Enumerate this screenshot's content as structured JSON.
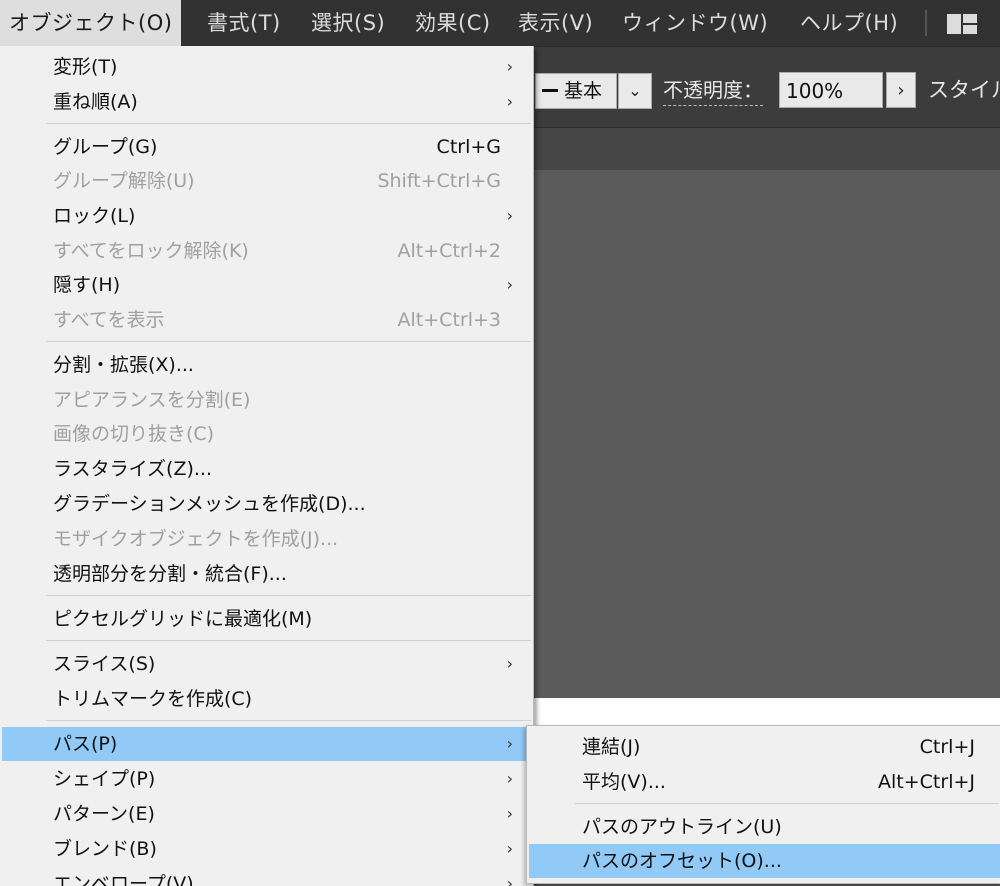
{
  "menubar": {
    "items": [
      "オブジェクト(O)",
      "書式(T)",
      "選択(S)",
      "効果(C)",
      "表示(V)",
      "ウィンドウ(W)",
      "ヘルプ(H)"
    ],
    "workspace_icon": "workspace-layout-icon"
  },
  "controlbar": {
    "stroke_style": "基本",
    "opacity_label": "不透明度：",
    "opacity_value": "100%",
    "style_label": "スタイル"
  },
  "object_menu": {
    "items": [
      {
        "label": "変形(T)",
        "shortcut": "",
        "submenu": true,
        "disabled": false
      },
      {
        "label": "重ね順(A)",
        "shortcut": "",
        "submenu": true,
        "disabled": false
      },
      {
        "label": "グループ(G)",
        "shortcut": "Ctrl+G",
        "submenu": false,
        "disabled": false
      },
      {
        "label": "グループ解除(U)",
        "shortcut": "Shift+Ctrl+G",
        "submenu": false,
        "disabled": true
      },
      {
        "label": "ロック(L)",
        "shortcut": "",
        "submenu": true,
        "disabled": false
      },
      {
        "label": "すべてをロック解除(K)",
        "shortcut": "Alt+Ctrl+2",
        "submenu": false,
        "disabled": true
      },
      {
        "label": "隠す(H)",
        "shortcut": "",
        "submenu": true,
        "disabled": false
      },
      {
        "label": "すべてを表示",
        "shortcut": "Alt+Ctrl+3",
        "submenu": false,
        "disabled": true
      },
      {
        "label": "分割・拡張(X)...",
        "shortcut": "",
        "submenu": false,
        "disabled": false
      },
      {
        "label": "アピアランスを分割(E)",
        "shortcut": "",
        "submenu": false,
        "disabled": true
      },
      {
        "label": "画像の切り抜き(C)",
        "shortcut": "",
        "submenu": false,
        "disabled": true
      },
      {
        "label": "ラスタライズ(Z)...",
        "shortcut": "",
        "submenu": false,
        "disabled": false
      },
      {
        "label": "グラデーションメッシュを作成(D)...",
        "shortcut": "",
        "submenu": false,
        "disabled": false
      },
      {
        "label": "モザイクオブジェクトを作成(J)...",
        "shortcut": "",
        "submenu": false,
        "disabled": true
      },
      {
        "label": "透明部分を分割・統合(F)...",
        "shortcut": "",
        "submenu": false,
        "disabled": false
      },
      {
        "label": "ピクセルグリッドに最適化(M)",
        "shortcut": "",
        "submenu": false,
        "disabled": false
      },
      {
        "label": "スライス(S)",
        "shortcut": "",
        "submenu": true,
        "disabled": false
      },
      {
        "label": "トリムマークを作成(C)",
        "shortcut": "",
        "submenu": false,
        "disabled": false
      },
      {
        "label": "パス(P)",
        "shortcut": "",
        "submenu": true,
        "disabled": false,
        "highlighted": true
      },
      {
        "label": "シェイプ(P)",
        "shortcut": "",
        "submenu": true,
        "disabled": false
      },
      {
        "label": "パターン(E)",
        "shortcut": "",
        "submenu": true,
        "disabled": false
      },
      {
        "label": "ブレンド(B)",
        "shortcut": "",
        "submenu": true,
        "disabled": false
      },
      {
        "label": "エンベロープ(V)",
        "shortcut": "",
        "submenu": true,
        "disabled": false
      }
    ]
  },
  "path_submenu": {
    "items": [
      {
        "label": "連結(J)",
        "shortcut": "Ctrl+J"
      },
      {
        "label": "平均(V)...",
        "shortcut": "Alt+Ctrl+J"
      },
      {
        "label": "パスのアウトライン(U)",
        "shortcut": ""
      },
      {
        "label": "パスのオフセット(O)...",
        "shortcut": "",
        "highlighted": true
      }
    ]
  },
  "colors": {
    "highlight": "#91c9f7",
    "menubar_bg": "#323232",
    "menu_bg": "#f0f0f0"
  }
}
